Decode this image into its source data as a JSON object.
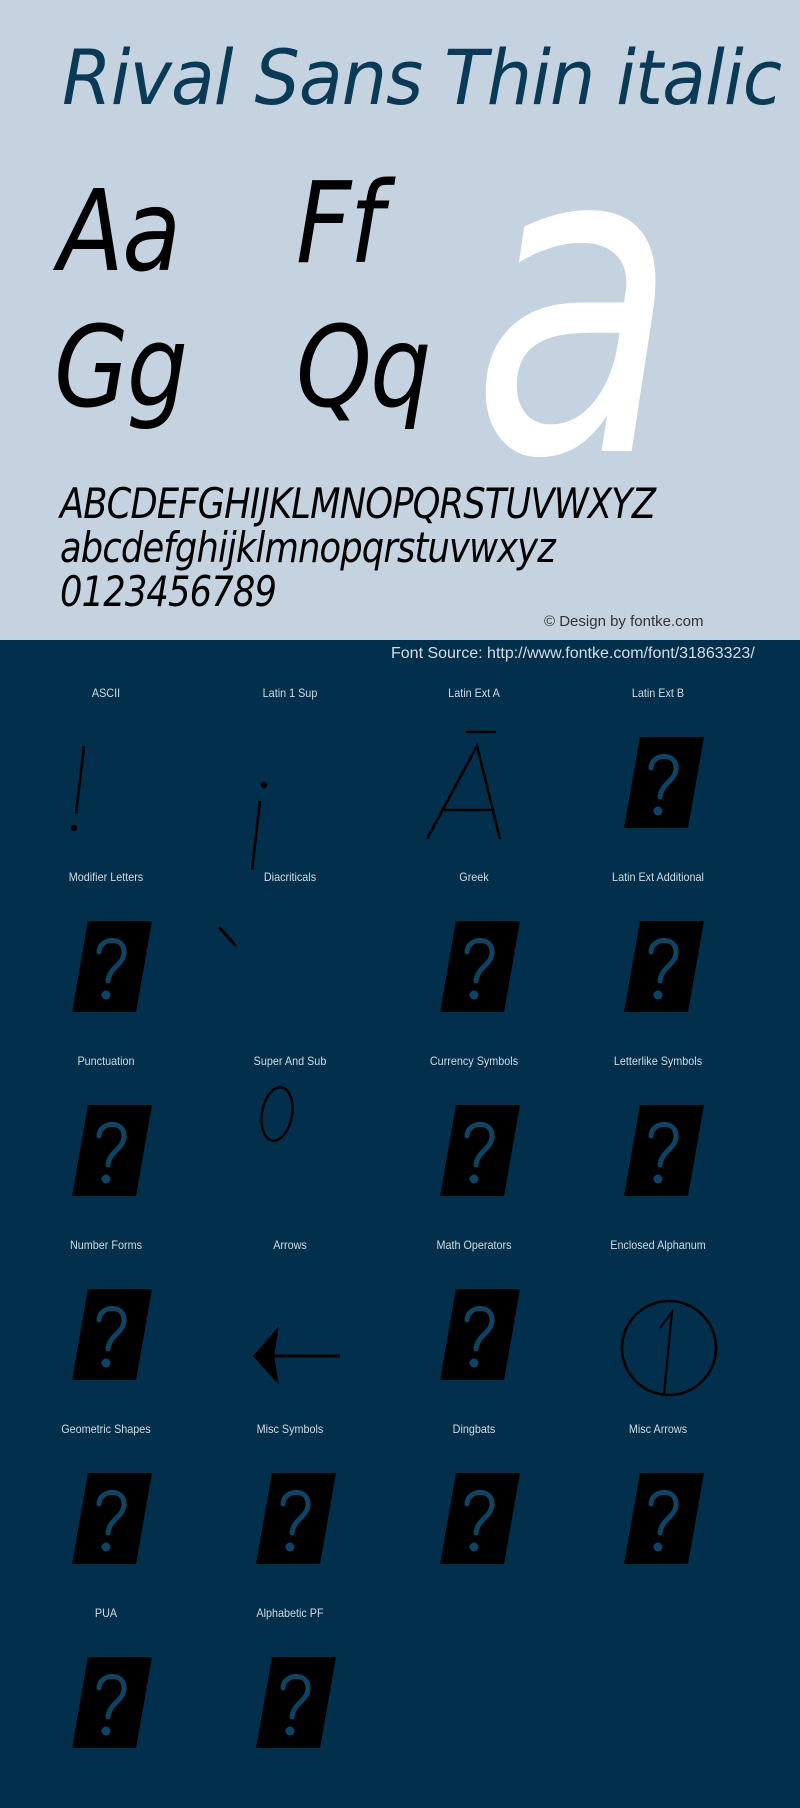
{
  "preview": {
    "title": "Rival Sans Thin italic",
    "pairs": [
      "Aa",
      "Ff",
      "Gg",
      "Qq"
    ],
    "big_glyph": "a",
    "uppercase": "ABCDEFGHIJKLMNOPQRSTUVWXYZ",
    "lowercase": "abcdefghijklmnopqrstuvwxyz",
    "digits": "0123456789",
    "credit": "© Design by fontke.com"
  },
  "source": "Font Source: http://www.fontke.com/font/31863323/",
  "colors": {
    "preview_bg": "#c4d3df",
    "title": "#0b3a57",
    "page_bg": "#022f4b",
    "missing_box": "#000000",
    "missing_mark": "#0e4463",
    "big_glyph": "#ffffff"
  },
  "blocks": [
    {
      "label": "ASCII",
      "glyph": "exclamation"
    },
    {
      "label": "Latin 1 Sup",
      "glyph": "inverted-exclamation"
    },
    {
      "label": "Latin Ext A",
      "glyph": "a-macron"
    },
    {
      "label": "Latin Ext B",
      "glyph": "missing"
    },
    {
      "label": "Modifier Letters",
      "glyph": "missing"
    },
    {
      "label": "Diacriticals",
      "glyph": "grave-accent"
    },
    {
      "label": "Greek",
      "glyph": "missing"
    },
    {
      "label": "Latin Ext Additional",
      "glyph": "missing"
    },
    {
      "label": "Punctuation",
      "glyph": "missing"
    },
    {
      "label": "Super And Sub",
      "glyph": "superscript-zero"
    },
    {
      "label": "Currency Symbols",
      "glyph": "missing"
    },
    {
      "label": "Letterlike Symbols",
      "glyph": "missing"
    },
    {
      "label": "Number Forms",
      "glyph": "missing"
    },
    {
      "label": "Arrows",
      "glyph": "left-arrow"
    },
    {
      "label": "Math Operators",
      "glyph": "missing"
    },
    {
      "label": "Enclosed Alphanum",
      "glyph": "circled-one"
    },
    {
      "label": "Geometric Shapes",
      "glyph": "missing"
    },
    {
      "label": "Misc Symbols",
      "glyph": "missing"
    },
    {
      "label": "Dingbats",
      "glyph": "missing"
    },
    {
      "label": "Misc Arrows",
      "glyph": "missing"
    },
    {
      "label": "PUA",
      "glyph": "missing"
    },
    {
      "label": "Alphabetic PF",
      "glyph": "missing"
    }
  ]
}
